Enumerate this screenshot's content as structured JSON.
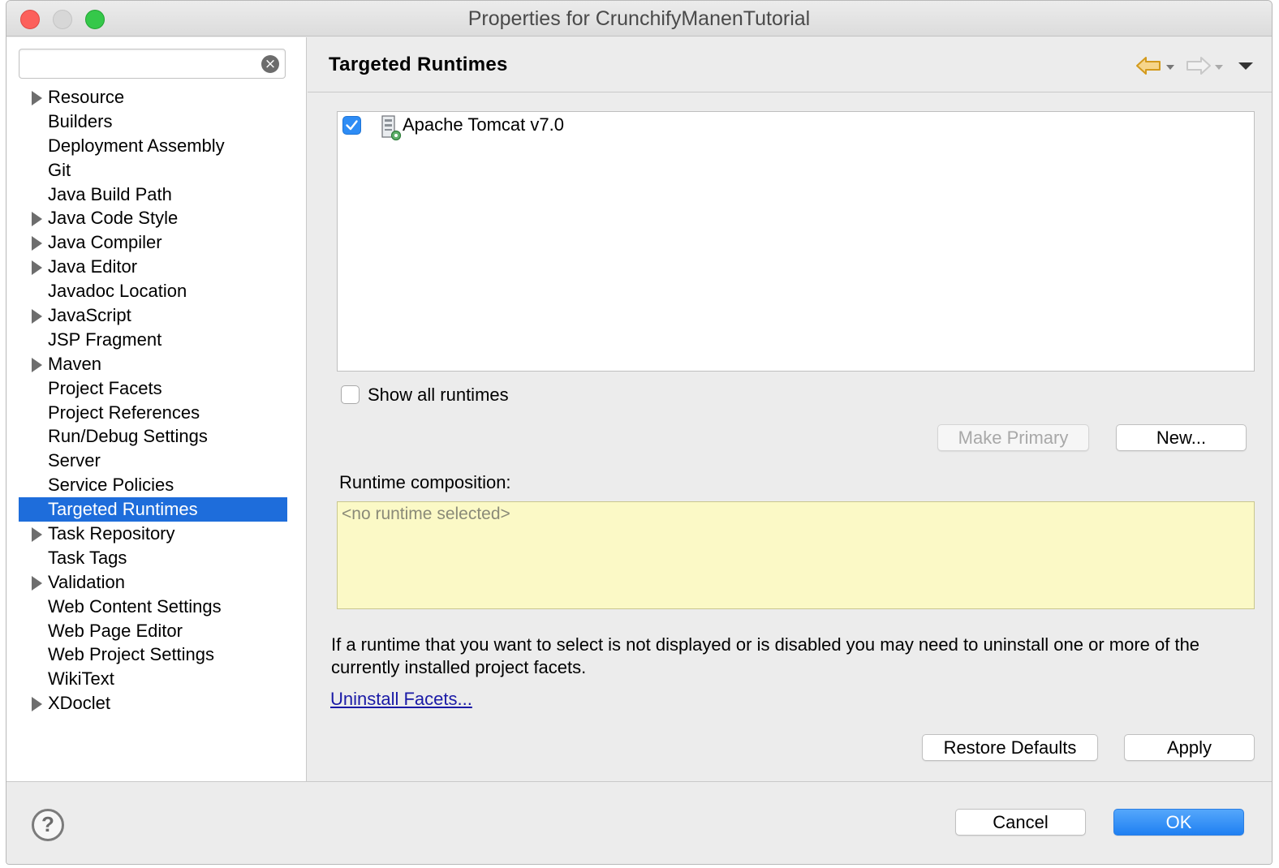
{
  "window": {
    "title": "Properties for CrunchifyManenTutorial"
  },
  "sidebar": {
    "filter_placeholder": "",
    "items": [
      {
        "label": "Resource",
        "expandable": true
      },
      {
        "label": "Builders",
        "expandable": false
      },
      {
        "label": "Deployment Assembly",
        "expandable": false
      },
      {
        "label": "Git",
        "expandable": false
      },
      {
        "label": "Java Build Path",
        "expandable": false
      },
      {
        "label": "Java Code Style",
        "expandable": true
      },
      {
        "label": "Java Compiler",
        "expandable": true
      },
      {
        "label": "Java Editor",
        "expandable": true
      },
      {
        "label": "Javadoc Location",
        "expandable": false
      },
      {
        "label": "JavaScript",
        "expandable": true
      },
      {
        "label": "JSP Fragment",
        "expandable": false
      },
      {
        "label": "Maven",
        "expandable": true
      },
      {
        "label": "Project Facets",
        "expandable": false
      },
      {
        "label": "Project References",
        "expandable": false
      },
      {
        "label": "Run/Debug Settings",
        "expandable": false
      },
      {
        "label": "Server",
        "expandable": false
      },
      {
        "label": "Service Policies",
        "expandable": false
      },
      {
        "label": "Targeted Runtimes",
        "expandable": false,
        "selected": true
      },
      {
        "label": "Task Repository",
        "expandable": true
      },
      {
        "label": "Task Tags",
        "expandable": false
      },
      {
        "label": "Validation",
        "expandable": true
      },
      {
        "label": "Web Content Settings",
        "expandable": false
      },
      {
        "label": "Web Page Editor",
        "expandable": false
      },
      {
        "label": "Web Project Settings",
        "expandable": false
      },
      {
        "label": "WikiText",
        "expandable": false
      },
      {
        "label": "XDoclet",
        "expandable": true
      }
    ]
  },
  "page": {
    "title": "Targeted Runtimes",
    "runtimes": [
      {
        "label": "Apache Tomcat v7.0",
        "checked": true
      }
    ],
    "show_all_label": "Show all runtimes",
    "show_all_checked": false,
    "make_primary_label": "Make Primary",
    "new_label": "New...",
    "composition_label": "Runtime composition:",
    "composition_placeholder": "<no runtime selected>",
    "info_text": "If a runtime that you want to select is not displayed or is disabled you may need to uninstall one or more of the currently installed project facets.",
    "uninstall_link": "Uninstall Facets...",
    "restore_defaults_label": "Restore Defaults",
    "apply_label": "Apply"
  },
  "footer": {
    "cancel_label": "Cancel",
    "ok_label": "OK"
  },
  "colors": {
    "selection": "#1e6ddb",
    "composition_bg": "#fbf9c6",
    "ok_button": "#1f80f2",
    "checkbox_on": "#2d8cf5"
  },
  "icons": {
    "back": "back-arrow-icon",
    "forward": "forward-arrow-icon",
    "menu": "view-menu-icon",
    "help": "help-icon",
    "clear": "clear-icon",
    "server": "server-icon"
  }
}
